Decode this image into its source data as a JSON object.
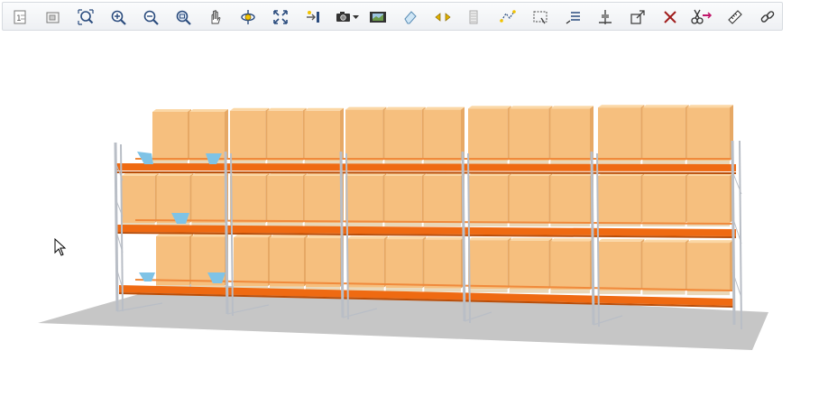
{
  "toolbar": {
    "buttons": [
      {
        "name": "fit-to-page-icon"
      },
      {
        "name": "zoom-selection-icon"
      },
      {
        "name": "zoom-extents-icon"
      },
      {
        "name": "zoom-in-icon"
      },
      {
        "name": "zoom-out-icon"
      },
      {
        "name": "zoom-window-icon"
      },
      {
        "name": "pan-hand-icon"
      },
      {
        "name": "orbit-rotate-icon"
      },
      {
        "name": "fit-view-icon"
      },
      {
        "name": "insert-point-icon"
      },
      {
        "name": "camera-icon"
      },
      {
        "name": "film-strip-icon"
      },
      {
        "name": "eraser-icon"
      },
      {
        "name": "move-arrows-icon"
      },
      {
        "name": "stacked-pages-icon"
      },
      {
        "name": "select-polygon-icon"
      },
      {
        "name": "select-window-icon"
      },
      {
        "name": "text-annotation-icon"
      },
      {
        "name": "align-icon"
      },
      {
        "name": "scale-icon"
      },
      {
        "name": "delete-icon"
      },
      {
        "name": "cut-icon"
      },
      {
        "name": "measure-icon"
      },
      {
        "name": "link-icon"
      }
    ]
  },
  "colors": {
    "beam": "#ef6a12",
    "upright": "#b9bec6",
    "box_front": "#f6bf7e",
    "box_top": "#fbd7a5",
    "box_side": "#e6a865",
    "floor": "#c6c6c6",
    "deflector": "#7fc3e6"
  }
}
